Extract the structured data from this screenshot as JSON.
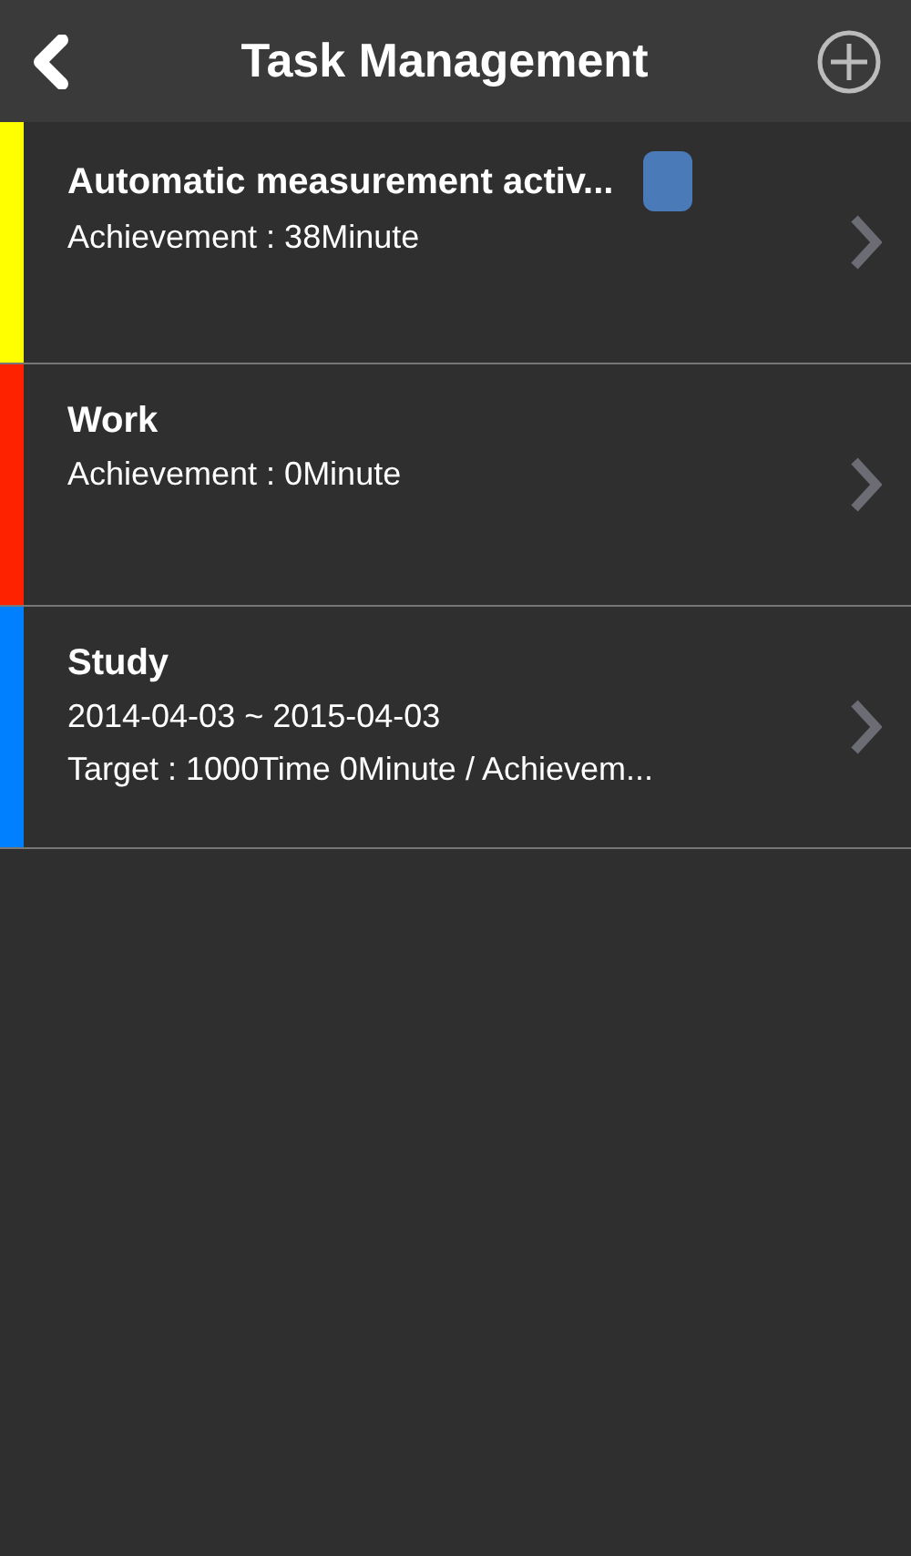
{
  "header": {
    "title": "Task Management"
  },
  "tasks": [
    {
      "name": "Automatic measurement activ...",
      "color": "#ffff00",
      "measuring": true,
      "lines": [
        "Achievement : 38Minute"
      ]
    },
    {
      "name": "Work",
      "color": "#ff2200",
      "measuring": false,
      "lines": [
        "Achievement : 0Minute"
      ]
    },
    {
      "name": "Study",
      "color": "#0080ff",
      "measuring": false,
      "lines": [
        "2014-04-03 ~ 2015-04-03",
        "Target : 1000Time 0Minute / Achievem..."
      ]
    }
  ]
}
